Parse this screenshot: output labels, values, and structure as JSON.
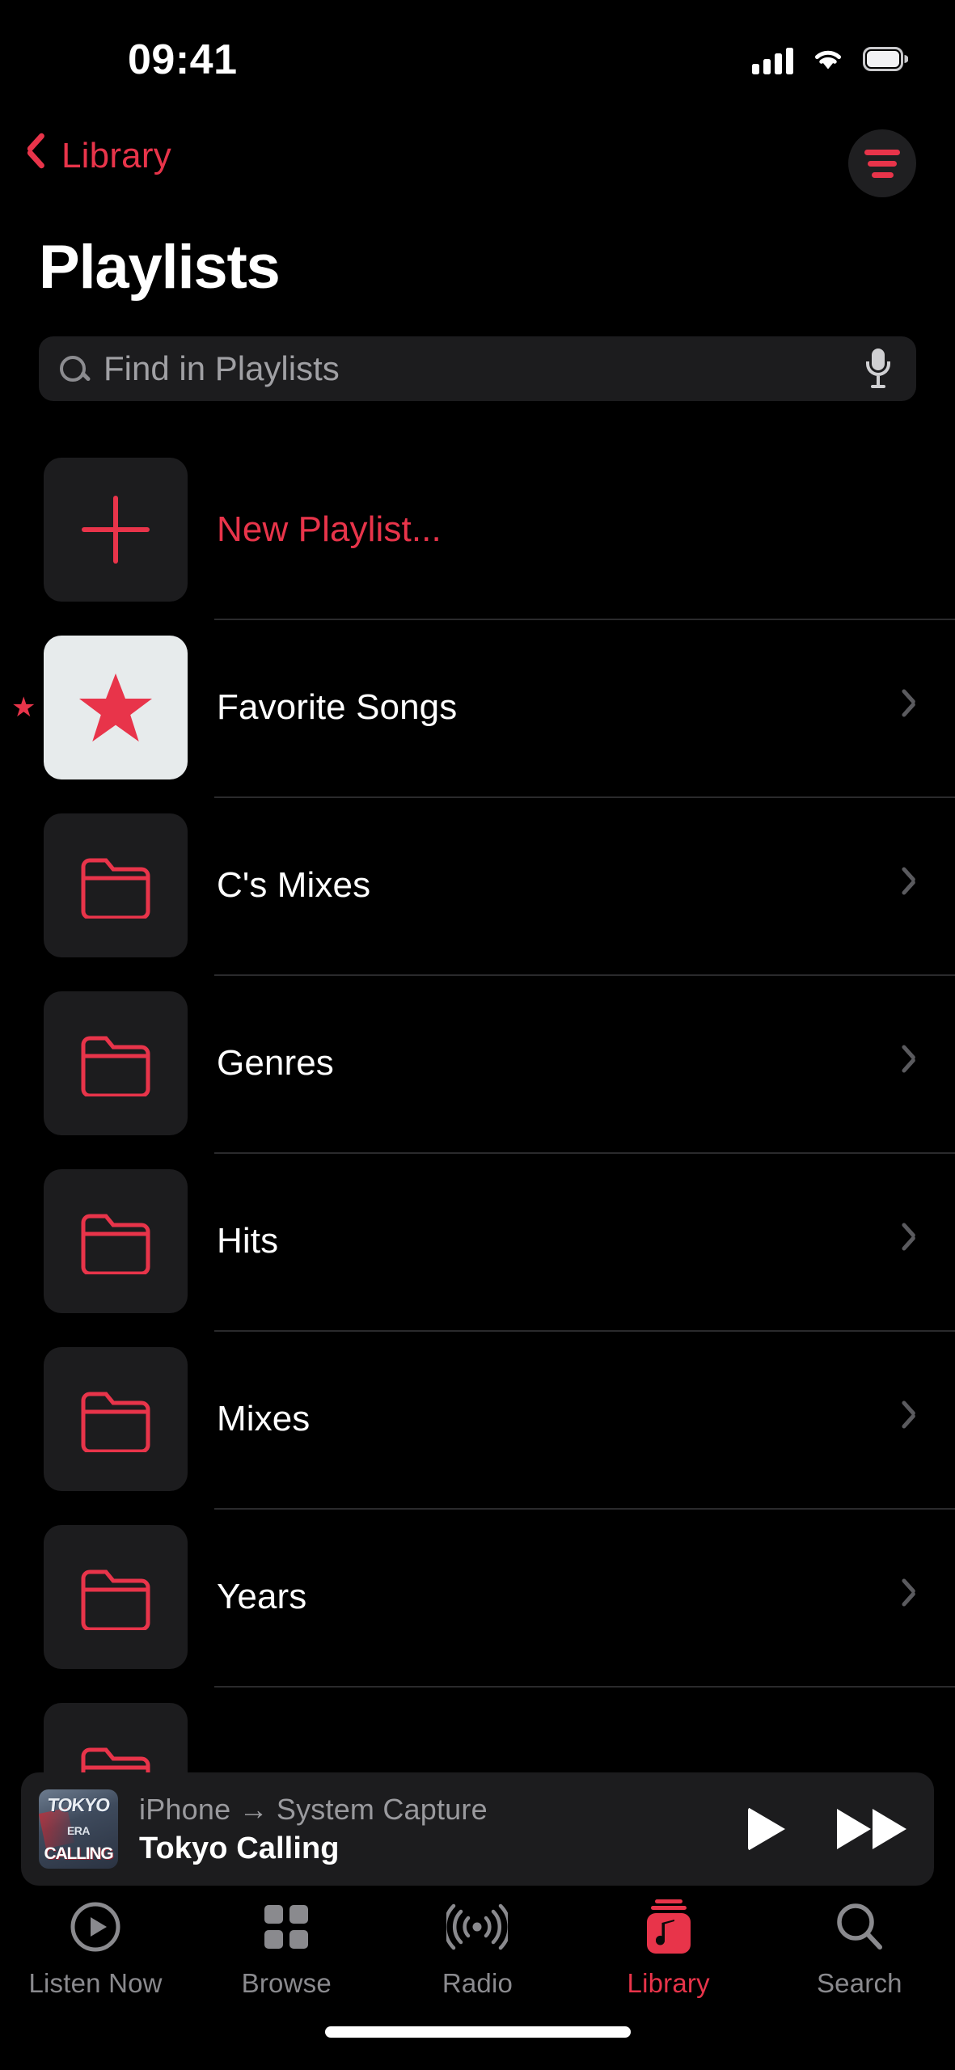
{
  "status_bar": {
    "time": "09:41",
    "signal_icon": "cellular-signal-icon",
    "signal_bars": 4,
    "wifi_icon": "wifi-icon",
    "battery_icon": "battery-full-icon"
  },
  "nav": {
    "back_label": "Library",
    "back_icon": "chevron-left-icon",
    "sort_icon": "sort-filter-icon",
    "accent_color": "#E8344A"
  },
  "header": {
    "title": "Playlists"
  },
  "search": {
    "placeholder": "Find in Playlists",
    "value": "",
    "search_icon": "search-icon",
    "mic_icon": "microphone-icon"
  },
  "playlists": [
    {
      "label": "New Playlist...",
      "icon": "plus-icon",
      "tile": "dark",
      "accent": true,
      "chevron": false,
      "marker": false
    },
    {
      "label": "Favorite Songs",
      "icon": "star-icon",
      "tile": "light",
      "accent": false,
      "chevron": true,
      "marker": "★"
    },
    {
      "label": "C's Mixes",
      "icon": "folder-icon",
      "tile": "dark",
      "accent": false,
      "chevron": true,
      "marker": false
    },
    {
      "label": "Genres",
      "icon": "folder-icon",
      "tile": "dark",
      "accent": false,
      "chevron": true,
      "marker": false
    },
    {
      "label": "Hits",
      "icon": "folder-icon",
      "tile": "dark",
      "accent": false,
      "chevron": true,
      "marker": false
    },
    {
      "label": "Mixes",
      "icon": "folder-icon",
      "tile": "dark",
      "accent": false,
      "chevron": true,
      "marker": false
    },
    {
      "label": "Years",
      "icon": "folder-icon",
      "tile": "dark",
      "accent": false,
      "chevron": true,
      "marker": false
    }
  ],
  "now_playing": {
    "route": "iPhone → System Capture",
    "track_title": "Tokyo Calling",
    "artwork_lines": [
      "TOKYO",
      "ERA",
      "CALLING"
    ],
    "artwork_name": "album-artwork",
    "play_icon": "play-icon",
    "forward_icon": "fast-forward-icon"
  },
  "tabs": [
    {
      "label": "Listen Now",
      "icon": "play-circle-icon",
      "active": false
    },
    {
      "label": "Browse",
      "icon": "grid-icon",
      "active": false
    },
    {
      "label": "Radio",
      "icon": "radio-waves-icon",
      "active": false
    },
    {
      "label": "Library",
      "icon": "music-library-icon",
      "active": true
    },
    {
      "label": "Search",
      "icon": "search-icon",
      "active": false
    }
  ],
  "home_indicator": "home-indicator"
}
